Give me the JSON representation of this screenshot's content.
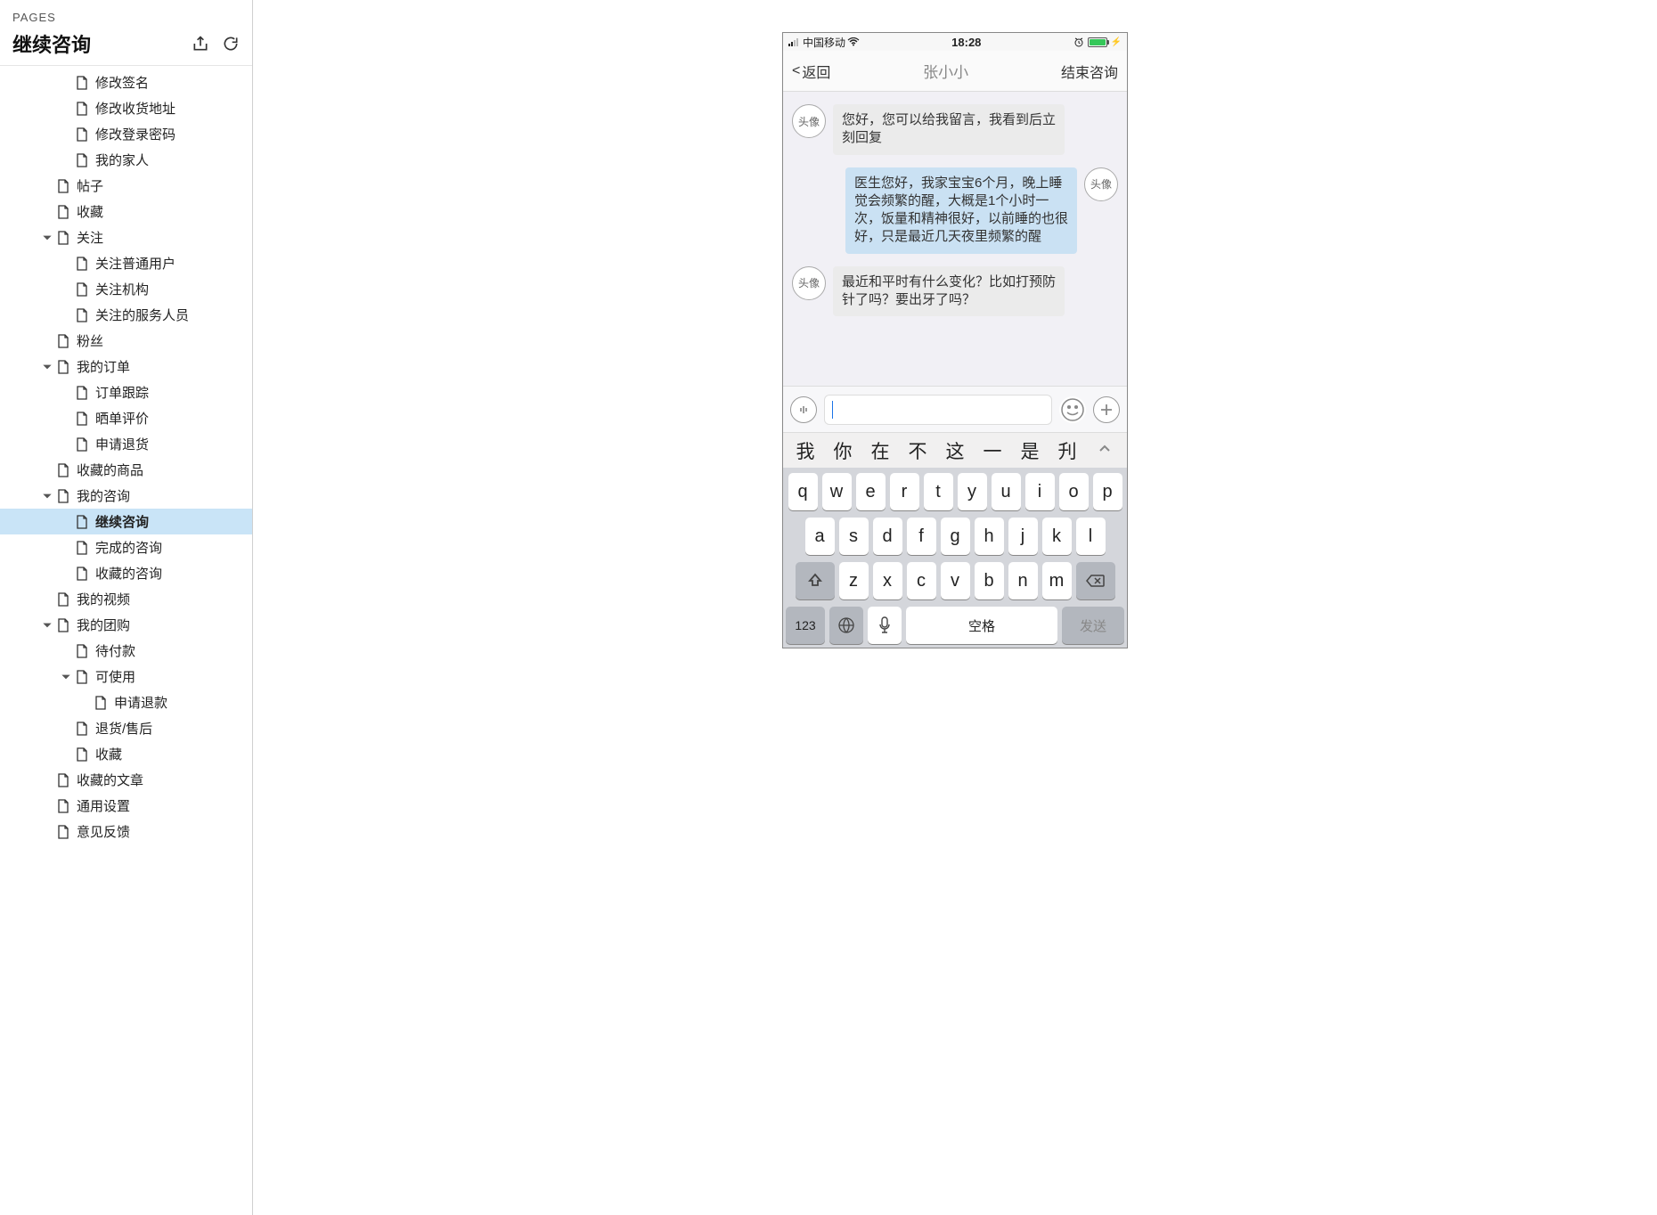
{
  "sidebar": {
    "pages_label": "PAGES",
    "title": "继续咨询",
    "items": [
      {
        "level": 3,
        "label": "修改签名"
      },
      {
        "level": 3,
        "label": "修改收货地址"
      },
      {
        "level": 3,
        "label": "修改登录密码"
      },
      {
        "level": 3,
        "label": "我的家人"
      },
      {
        "level": 2,
        "label": "帖子"
      },
      {
        "level": 2,
        "label": "收藏"
      },
      {
        "level": 2,
        "label": "关注",
        "expandable": true
      },
      {
        "level": 3,
        "label": "关注普通用户"
      },
      {
        "level": 3,
        "label": "关注机构"
      },
      {
        "level": 3,
        "label": "关注的服务人员"
      },
      {
        "level": 2,
        "label": "粉丝"
      },
      {
        "level": 2,
        "label": "我的订单",
        "expandable": true
      },
      {
        "level": 3,
        "label": "订单跟踪"
      },
      {
        "level": 3,
        "label": "晒单评价"
      },
      {
        "level": 3,
        "label": "申请退货"
      },
      {
        "level": 2,
        "label": "收藏的商品"
      },
      {
        "level": 2,
        "label": "我的咨询",
        "expandable": true
      },
      {
        "level": 3,
        "label": "继续咨询",
        "selected": true
      },
      {
        "level": 3,
        "label": "完成的咨询"
      },
      {
        "level": 3,
        "label": "收藏的咨询"
      },
      {
        "level": 2,
        "label": "我的视频"
      },
      {
        "level": 2,
        "label": "我的团购",
        "expandable": true
      },
      {
        "level": 3,
        "label": "待付款"
      },
      {
        "level": 3,
        "label": "可使用",
        "expandable": true
      },
      {
        "level": 4,
        "label": "申请退款"
      },
      {
        "level": 3,
        "label": "退货/售后"
      },
      {
        "level": 3,
        "label": "收藏"
      },
      {
        "level": 2,
        "label": "收藏的文章"
      },
      {
        "level": 2,
        "label": "通用设置"
      },
      {
        "level": 2,
        "label": "意见反馈"
      }
    ]
  },
  "phone": {
    "status": {
      "carrier": "中国移动",
      "time": "18:28"
    },
    "nav": {
      "back": "返回",
      "title": "张小小",
      "action": "结束咨询"
    },
    "avatar_label": "头像",
    "messages": [
      {
        "side": "left",
        "text": "您好，您可以给我留言，我看到后立刻回复"
      },
      {
        "side": "right",
        "text": "医生您好，我家宝宝6个月，晚上睡觉会频繁的醒，大概是1个小时一次，饭量和精神很好，以前睡的也很好，只是最近几天夜里频繁的醒"
      },
      {
        "side": "left",
        "text": "最近和平时有什么变化？比如打预防针了吗？要出牙了吗？"
      }
    ],
    "ime_candidates": [
      "我",
      "你",
      "在",
      "不",
      "这",
      "一",
      "是",
      "刋"
    ],
    "keyboard": {
      "row1": [
        "q",
        "w",
        "e",
        "r",
        "t",
        "y",
        "u",
        "i",
        "o",
        "p"
      ],
      "row2": [
        "a",
        "s",
        "d",
        "f",
        "g",
        "h",
        "j",
        "k",
        "l"
      ],
      "row3": [
        "z",
        "x",
        "c",
        "v",
        "b",
        "n",
        "m"
      ],
      "numbers": "123",
      "space": "空格",
      "send": "发送"
    }
  }
}
